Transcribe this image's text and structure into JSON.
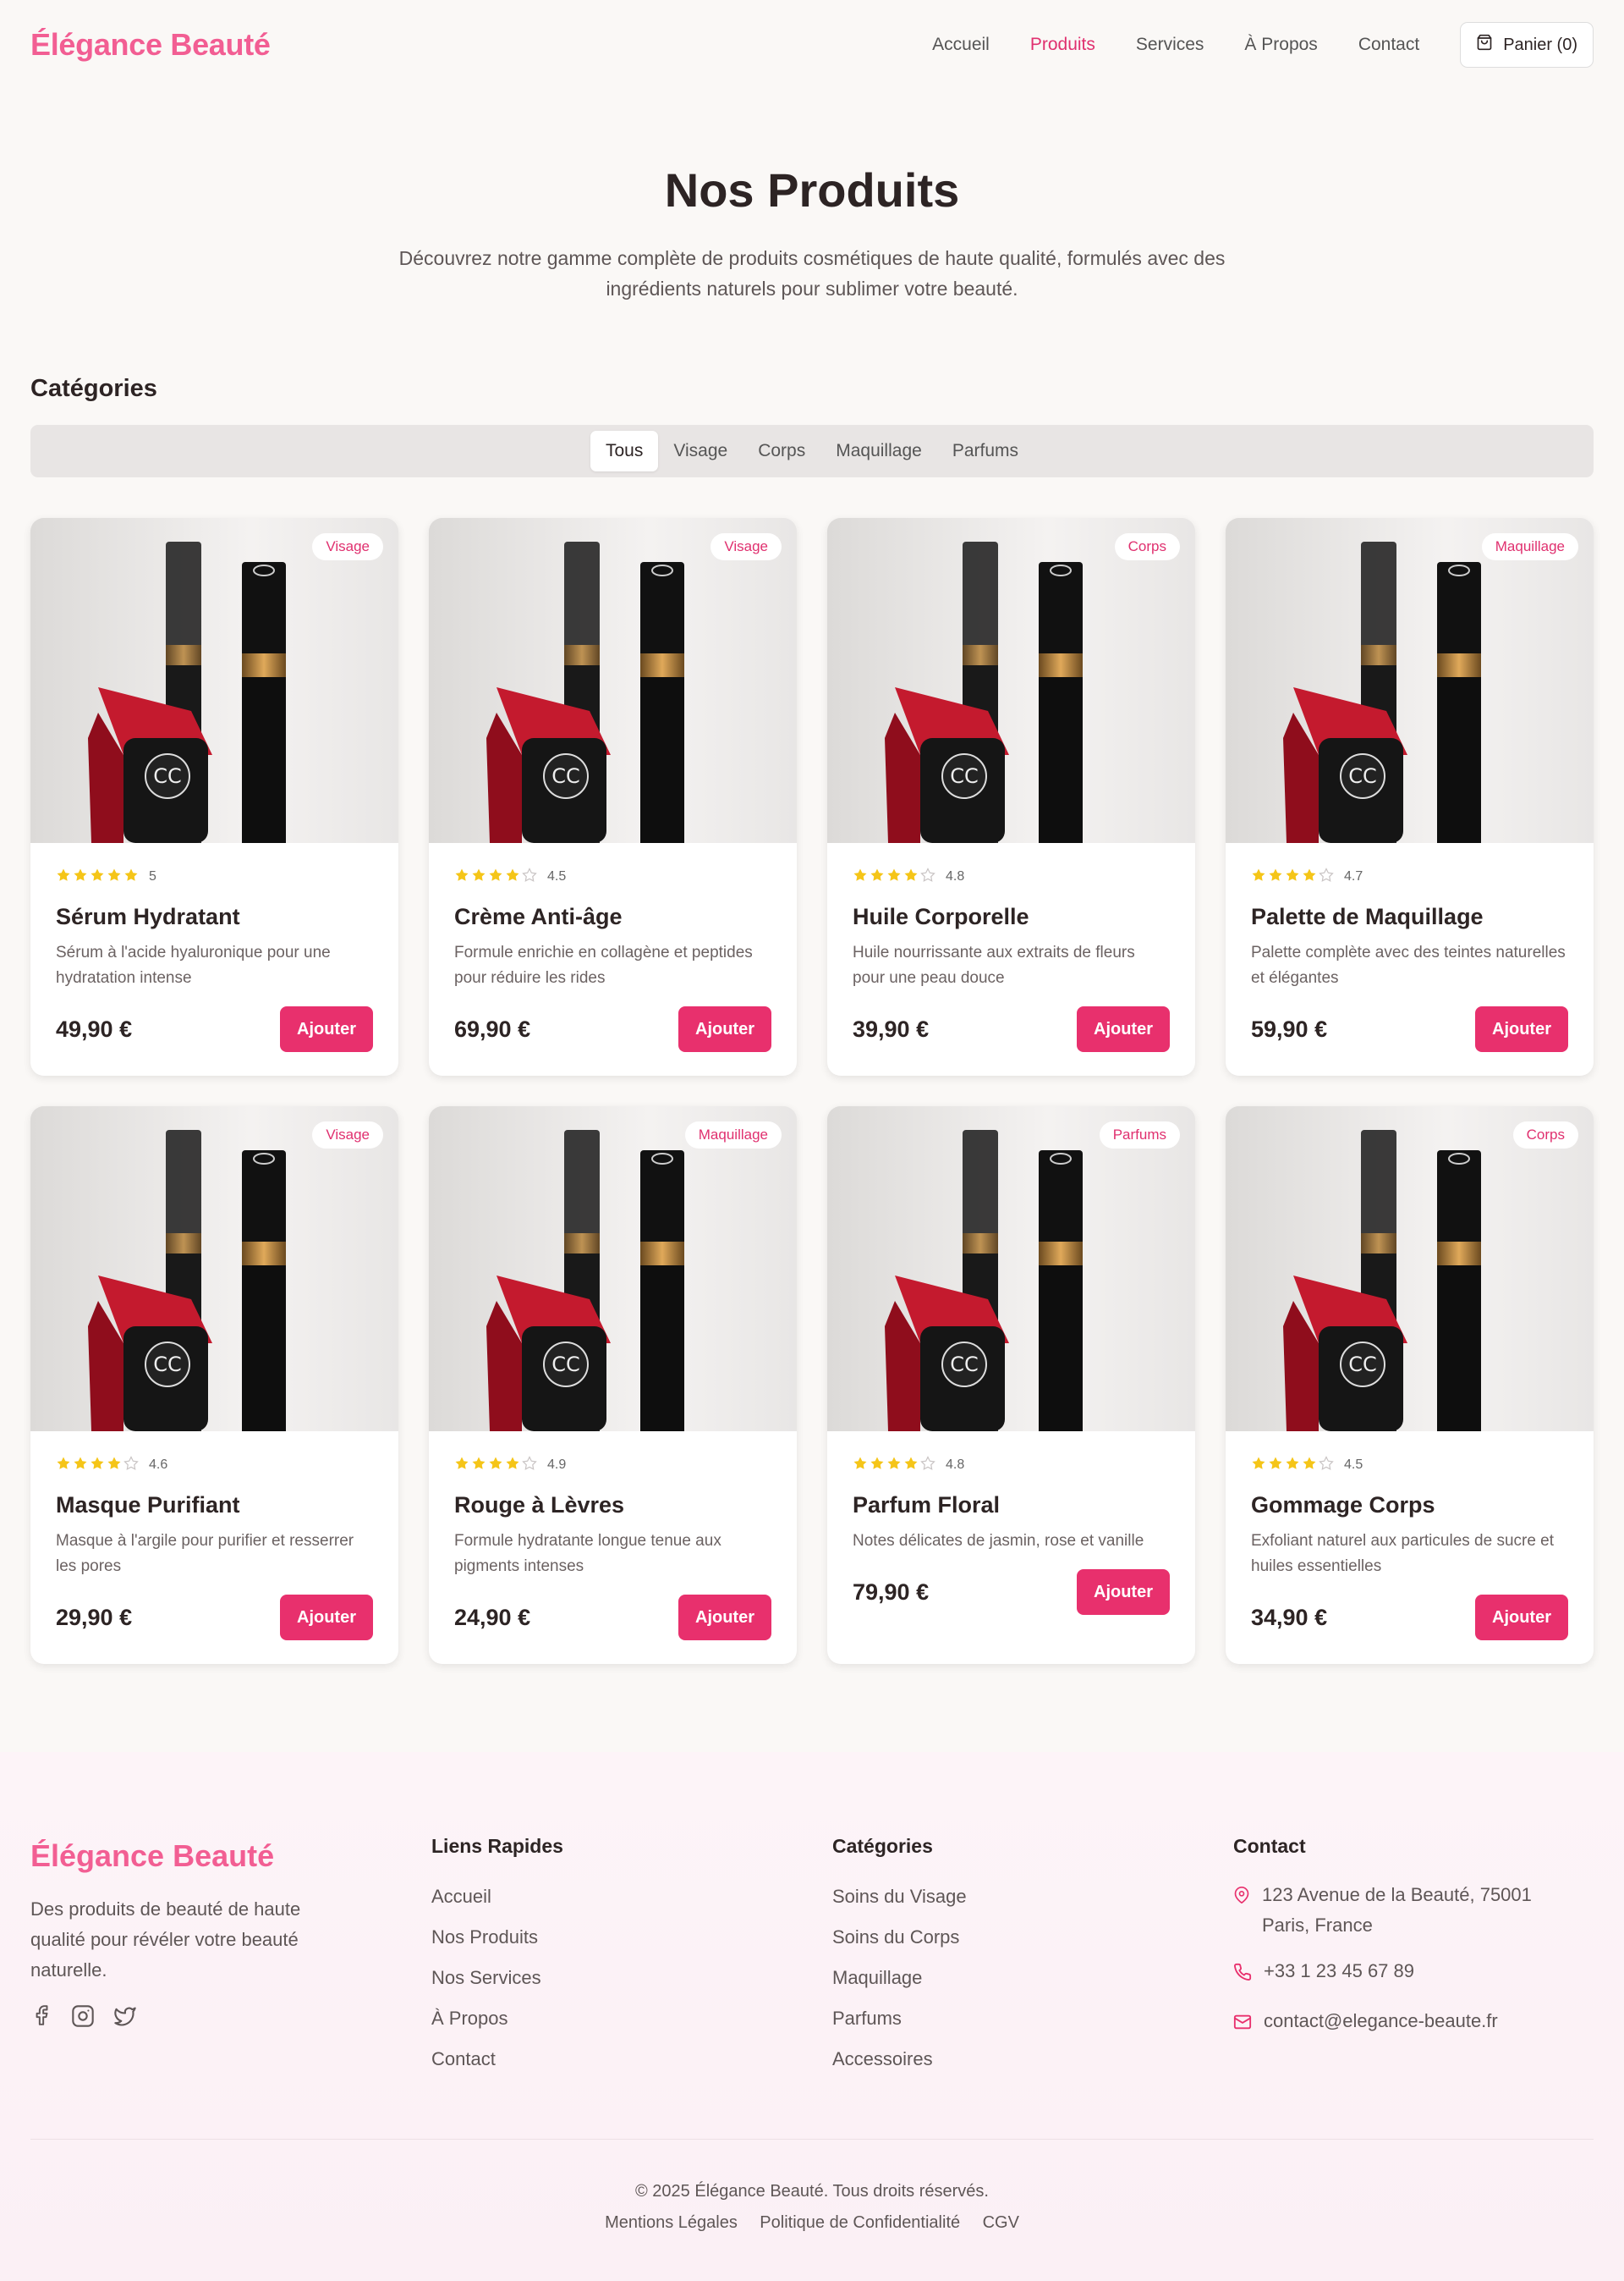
{
  "header": {
    "logo": "Élégance Beauté",
    "nav": [
      "Accueil",
      "Produits",
      "Services",
      "À Propos",
      "Contact"
    ],
    "active_nav": "Produits",
    "cart_label": "Panier (0)"
  },
  "hero": {
    "title": "Nos Produits",
    "subtitle": "Découvrez notre gamme complète de produits cosmétiques de haute qualité, formulés avec des ingrédients naturels pour sublimer votre beauté."
  },
  "categories": {
    "title": "Catégories",
    "tabs": [
      "Tous",
      "Visage",
      "Corps",
      "Maquillage",
      "Parfums"
    ],
    "active": "Tous"
  },
  "products": [
    {
      "badge": "Visage",
      "rating": "5",
      "stars": 5,
      "name": "Sérum Hydratant",
      "desc": "Sérum à l'acide hyaluronique pour une hydratation intense",
      "price": "49,90 €",
      "button": "Ajouter"
    },
    {
      "badge": "Visage",
      "rating": "4.5",
      "stars": 4,
      "name": "Crème Anti-âge",
      "desc": "Formule enrichie en collagène et peptides pour réduire les rides",
      "price": "69,90 €",
      "button": "Ajouter"
    },
    {
      "badge": "Corps",
      "rating": "4.8",
      "stars": 4,
      "name": "Huile Corporelle",
      "desc": "Huile nourrissante aux extraits de fleurs pour une peau douce",
      "price": "39,90 €",
      "button": "Ajouter"
    },
    {
      "badge": "Maquillage",
      "rating": "4.7",
      "stars": 4,
      "name": "Palette de Maquillage",
      "desc": "Palette complète avec des teintes naturelles et élégantes",
      "price": "59,90 €",
      "button": "Ajouter"
    },
    {
      "badge": "Visage",
      "rating": "4.6",
      "stars": 4,
      "name": "Masque Purifiant",
      "desc": "Masque à l'argile pour purifier et resserrer les pores",
      "price": "29,90 €",
      "button": "Ajouter"
    },
    {
      "badge": "Maquillage",
      "rating": "4.9",
      "stars": 4,
      "name": "Rouge à Lèvres",
      "desc": "Formule hydratante longue tenue aux pigments intenses",
      "price": "24,90 €",
      "button": "Ajouter"
    },
    {
      "badge": "Parfums",
      "rating": "4.8",
      "stars": 4,
      "name": "Parfum Floral",
      "desc": "Notes délicates de jasmin, rose et vanille",
      "price": "79,90 €",
      "button": "Ajouter"
    },
    {
      "badge": "Corps",
      "rating": "4.5",
      "stars": 4,
      "name": "Gommage Corps",
      "desc": "Exfoliant naturel aux particules de sucre et huiles essentielles",
      "price": "34,90 €",
      "button": "Ajouter"
    }
  ],
  "footer": {
    "logo": "Élégance Beauté",
    "about": "Des produits de beauté de haute qualité pour révéler votre beauté naturelle.",
    "socials": [
      "facebook-icon",
      "instagram-icon",
      "twitter-icon"
    ],
    "quick_links_title": "Liens Rapides",
    "quick_links": [
      "Accueil",
      "Nos Produits",
      "Nos Services",
      "À Propos",
      "Contact"
    ],
    "categories_title": "Catégories",
    "categories": [
      "Soins du Visage",
      "Soins du Corps",
      "Maquillage",
      "Parfums",
      "Accessoires"
    ],
    "contact_title": "Contact",
    "address": "123 Avenue de la Beauté, 75001 Paris, France",
    "phone": "+33 1 23 45 67 89",
    "email": "contact@elegance-beaute.fr",
    "copyright": "© 2025 Élégance Beauté. Tous droits réservés.",
    "legal": [
      "Mentions Légales",
      "Politique de Confidentialité",
      "CGV"
    ]
  },
  "colors": {
    "accent": "#e8306d",
    "logo": "#f25e93",
    "star": "#f5c518",
    "background": "#faf8f6"
  }
}
